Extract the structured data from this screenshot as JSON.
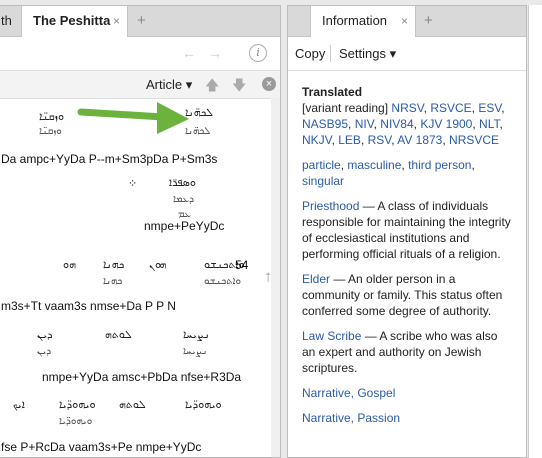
{
  "left_tabs": {
    "partial": "th",
    "active": "The Peshitta",
    "plus": "+",
    "close": "×"
  },
  "left_toolbar": {
    "article_label": "Article",
    "dropdown": "▾",
    "help": "i"
  },
  "verse_number": "54",
  "morph": [
    "Da ampc+YyDa P--m+Sm3pDa P+Sm3s",
    "nmpe+PeYyDc",
    "m3s+Tt vaam3s nmse+Da P P N",
    "nmpe+YyDa amsc+PbDa nfse+R3Da",
    "fse P+RcDa vaam3s+Pe nmpe+YyDc"
  ],
  "syriac": [
    "ܠܟܗ̈ܢܐ",
    "ܘܙܩܢ̈ܐ",
    "ܘܣܦܪ̈ܐ",
    "ܕܥܡܐ",
    "ܥܡ",
    "ܗܘ",
    "ܟܗܢܐ",
    "ܘܐܬܟܢܫܘ",
    "ܗܘܢ",
    "ܕܝܢ",
    "ܠܘܬܗ",
    "ܘܝܗܘܕ̈ܝܐ",
    "ܐܝܟ",
    "ܢܨܝܚܐ"
  ],
  "right_tabs": {
    "active": "Information",
    "plus": "+",
    "close": "×"
  },
  "right_toolbar": {
    "copy": "Copy",
    "settings": "Settings",
    "dropdown": "▾"
  },
  "info": {
    "heading": "Translated",
    "variant_label": "[variant reading]",
    "versions": [
      "NRSV",
      "RSVCE",
      "ESV",
      "NASB95",
      "NIV",
      "NIV84",
      "KJV 1900",
      "NLT",
      "NKJV",
      "LEB",
      "RSV",
      "AV 1873",
      "NRSVCE"
    ],
    "grammar": [
      "particle",
      "masculine",
      "third person",
      "singular"
    ],
    "priesthood": {
      "term": "Priesthood",
      "def": " — A class of individuals responsible for maintaining the integrity of ecclesiastical institutions and performing official rituals of a religion."
    },
    "elder": {
      "term": "Elder",
      "def": " — An older person in a community or family. This status often conferred some degree of authority."
    },
    "law_scribe": {
      "term": "Law Scribe",
      "def": " — A scribe who was also an expert and authority on Jewish scriptures."
    },
    "narrative_gospel": "Narrative, Gospel",
    "narrative_passion": "Narrative, Passion"
  },
  "colors": {
    "accent": "#2a5aa8",
    "arrow": "#6cb33e"
  }
}
